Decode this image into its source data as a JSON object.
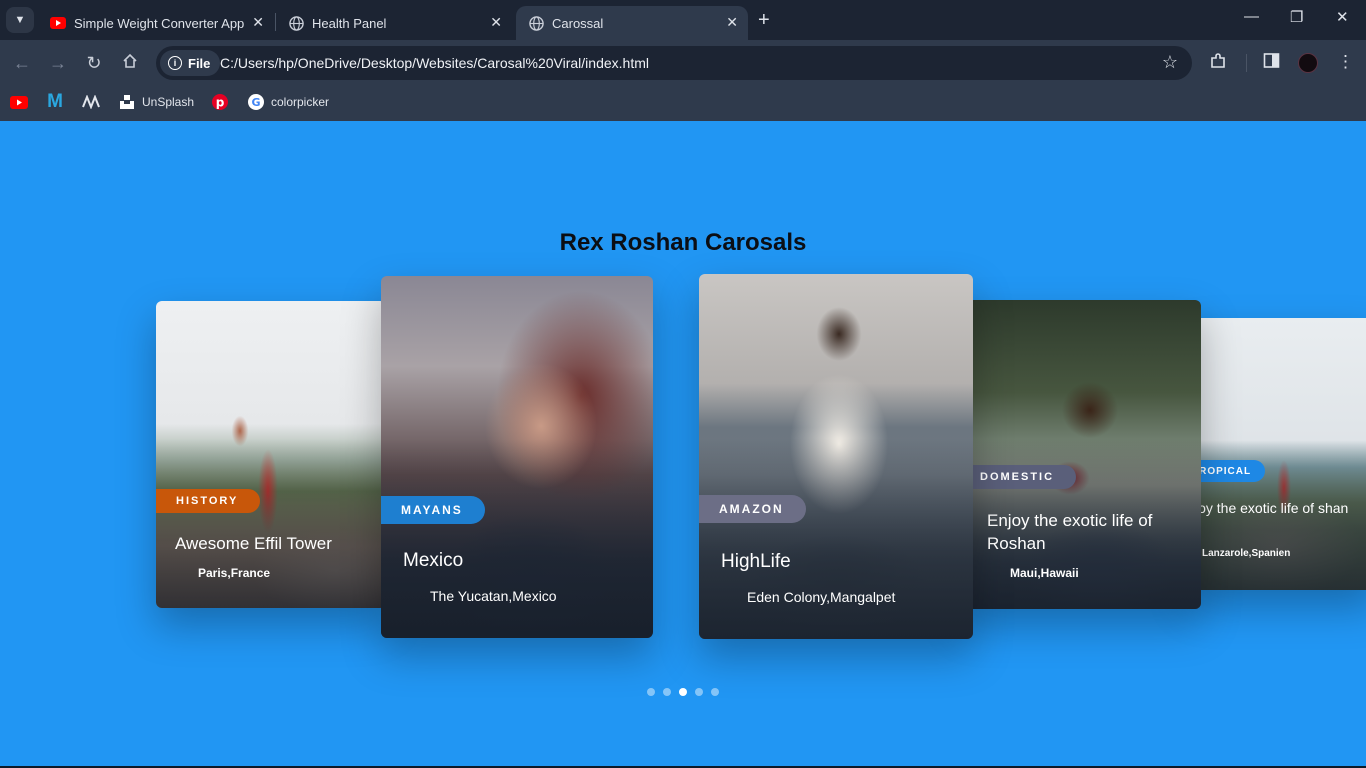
{
  "browser": {
    "tabs": [
      {
        "title": "Simple Weight Converter App W",
        "icon": "youtube-icon",
        "active": false
      },
      {
        "title": "Health Panel",
        "icon": "globe-icon",
        "active": false
      },
      {
        "title": "Carossal",
        "icon": "globe-icon",
        "active": true
      }
    ],
    "address": {
      "scheme_label": "File",
      "url": "C:/Users/hp/OneDrive/Desktop/Websites/Carosal%20Viral/index.html"
    },
    "bookmarks": [
      {
        "label": "",
        "icon": "youtube-icon"
      },
      {
        "label": "",
        "icon": "medium-m-icon"
      },
      {
        "label": "",
        "icon": "wave-logo-icon"
      },
      {
        "label": "UnSplash",
        "icon": "unsplash-icon"
      },
      {
        "label": "",
        "icon": "pinterest-icon"
      },
      {
        "label": "colorpicker",
        "icon": "google-icon"
      }
    ]
  },
  "page": {
    "heading": "Rex Roshan Carosals",
    "background": "#2196f3",
    "cards": [
      {
        "tag": "HISTORY",
        "tag_color": "#c8570a",
        "title": "Awesome Effil Tower",
        "location": "Paris,France"
      },
      {
        "tag": "MAYANS",
        "tag_color": "#1e7fd0",
        "title": "Mexico",
        "location": "The Yucatan,Mexico"
      },
      {
        "tag": "AMAZON",
        "tag_color": "#6c6e86",
        "title": "HighLife",
        "location": "Eden Colony,Mangalpet"
      },
      {
        "tag": "DOMESTIC",
        "tag_color": "#5a5f7a",
        "title": "Enjoy the exotic life of Roshan",
        "location": "Maui,Hawaii"
      },
      {
        "tag": "TROPICAL",
        "tag_color": "#1e88e5",
        "title": "joy the exotic life of shan",
        "location": "Lanzarole,Spanien"
      }
    ],
    "pagination": {
      "count": 5,
      "active_index": 2
    }
  }
}
